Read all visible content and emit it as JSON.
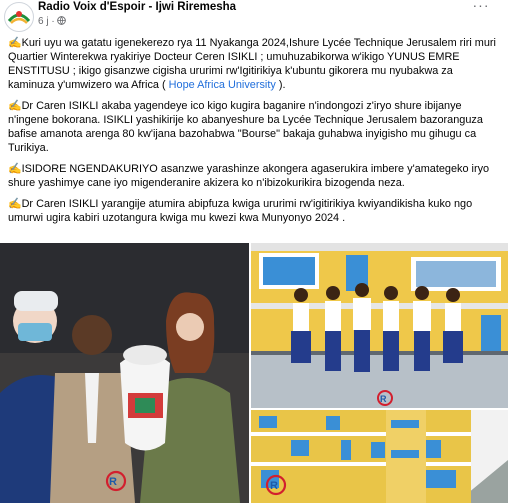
{
  "post": {
    "author": "Radio Voix d'Espoir - Ijwi Riremesha",
    "time": "6 j",
    "privacy_icon": "globe-icon",
    "more_icon": "more-options-icon"
  },
  "paragraphs": [
    {
      "emoji": "✍",
      "segments": [
        {
          "text": "Kuri uyu wa gatatu igenekerezo rya 11 Nyakanga 2024,Ishure Lycée Technique Jerusalem riri muri Quartier Winterekwa ryakiriye Docteur Ceren ISIKLI ; umuhuzabikorwa w'ikigo YUNUS EMRE ENSTITUSU ; ikigo gisanzwe cigisha ururimi rw'Igitirikiya k'ubuntu gikorera mu nyubakwa za kaminuza y'umwizero wa Africa (  "
        },
        {
          "text": "Hope Africa University",
          "link": true
        },
        {
          "text": " )."
        }
      ]
    },
    {
      "emoji": "✍",
      "segments": [
        {
          "text": "Dr Caren ISIKLI akaba yagendeye ico kigo kugira baganire n'indongozi z'iryo shure ibijanye n'ingene bokorana. ISIKLI yashikirije ko abanyeshure ba Lycée Technique Jerusalem bazoranguza bafise amanota arenga 80 kw'ijana bazohabwa \"Bourse\" bakaja guhabwa inyigisho mu gihugu ca Turikiya."
        }
      ]
    },
    {
      "emoji": "✍",
      "segments": [
        {
          "text": "ISIDORE NGENDAKURIYO asanzwe yarashinze akongera agaserukira imbere y'amategeko iryo shure yashimye cane iyo migenderanire akizera ko n'ibizokurikira bizogenda neza."
        }
      ]
    },
    {
      "emoji": "✍",
      "segments": [
        {
          "text": "Dr Caren ISIKLI yarangije atumira abipfuza kwiga ururimi rw'igitirikiya kwiyandikisha kuko ngo umurwi ugira kabiri uzotangura kwiga mu kwezi kwa Munyonyo 2024 ."
        }
      ]
    }
  ],
  "photos": {
    "left_alt": "Officials exchanging a gift basket",
    "top_right_alt": "Students in uniform in front of school building",
    "bottom_right_alt": "School building exterior"
  }
}
